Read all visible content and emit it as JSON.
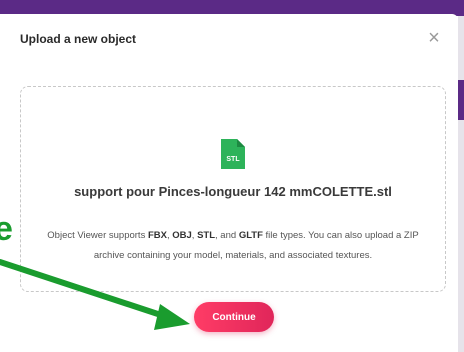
{
  "modal": {
    "title": "Upload a new object",
    "close_icon": "close-icon",
    "close_label": "×"
  },
  "dropzone": {
    "file_icon": "stl-file-icon",
    "file_badge": "STL",
    "file_name": "support pour Pinces-longueur 142 mmCOLETTE.stl",
    "support_text": {
      "prefix": "Object Viewer supports ",
      "fbx": "FBX",
      "sep1": ", ",
      "obj": "OBJ",
      "sep2": ", ",
      "stl": "STL",
      "sep3": ", and ",
      "gltf": "GLTF",
      "suffix": " file types. You can also upload a ZIP archive containing your model, materials, and associated textures."
    }
  },
  "actions": {
    "continue_label": "Continue"
  },
  "annotation": {
    "letter": "e",
    "arrow_icon": "green-arrow-icon"
  },
  "colors": {
    "accent_purple": "#5b2a86",
    "continue_gradient_start": "#ff3c66",
    "continue_gradient_end": "#e0265a",
    "file_icon_green": "#2db35a",
    "annotation_green": "#1a9c2e"
  }
}
